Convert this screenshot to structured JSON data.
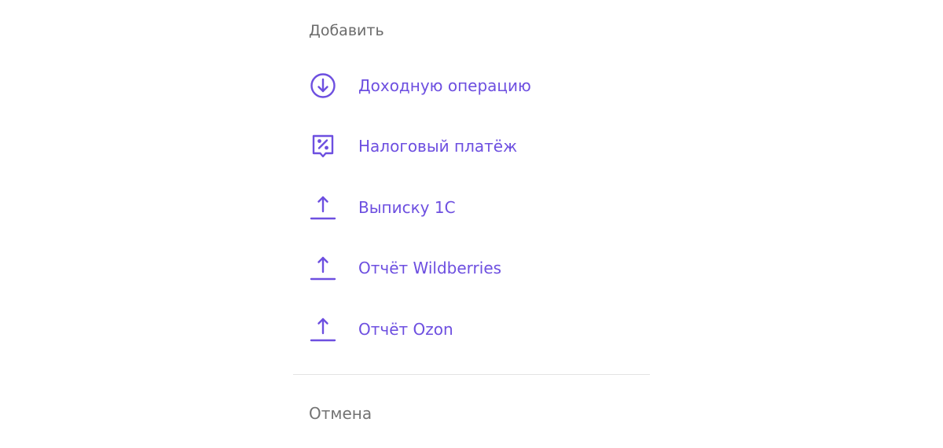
{
  "menu": {
    "title": "Добавить",
    "accent_color": "#6d4fe0",
    "items": [
      {
        "label": "Доходную операцию",
        "icon": "arrow-down-circle-icon"
      },
      {
        "label": "Налоговый платёж",
        "icon": "tax-receipt-percent-icon"
      },
      {
        "label": "Выписку 1С",
        "icon": "upload-icon"
      },
      {
        "label": "Отчёт Wildberries",
        "icon": "upload-icon"
      },
      {
        "label": "Отчёт Ozon",
        "icon": "upload-icon"
      }
    ],
    "cancel_label": "Отмена"
  }
}
